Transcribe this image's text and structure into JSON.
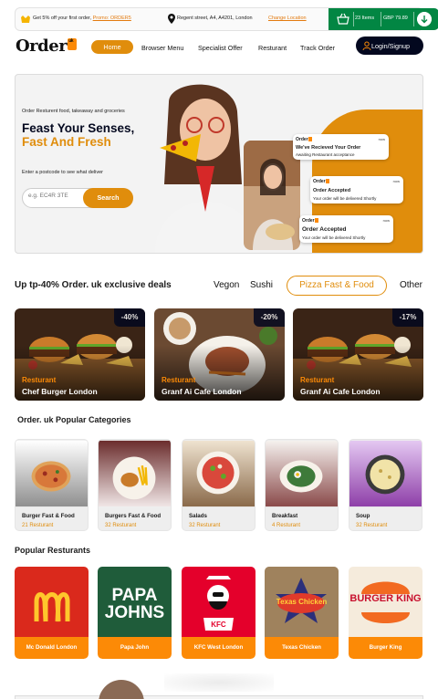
{
  "promo": {
    "text": "Get 5% off your first order, ",
    "code": "Promo: ORDER5",
    "address": "Regent street, A4, A4201, London",
    "change_location": "Change Location"
  },
  "cart": {
    "items": "23 Items",
    "price": "GBP 79.89"
  },
  "nav": {
    "logo": "Order",
    "logo_badge": "uk",
    "links": [
      "Home",
      "Browser Menu",
      "Specialist Offer",
      "Resturant",
      "Track Order"
    ],
    "login": "Login/Signup"
  },
  "hero": {
    "subtitle": "Order Resturent food, takeaway and groceries",
    "title_line1": "Feast Your Senses,",
    "title_line2": "Fast And Fresh",
    "postcode_label": "Enter a postcode to see what deliver",
    "search_placeholder": "e.g. EC4R 3TE",
    "search_button": "Search",
    "notifications": [
      {
        "brand": "Order",
        "time": "now",
        "title": "We've Recieved Your Order",
        "desc": "Awaiting Restaurant acceptance"
      },
      {
        "brand": "Order",
        "time": "now",
        "title": "Order Accepted",
        "desc": "Your order will be delivered Shortly"
      },
      {
        "brand": "Order",
        "time": "now",
        "title": "Order Accepted",
        "desc": "Your order will be delivered Shortly"
      }
    ]
  },
  "deals": {
    "title": "Up tp-40% Order. uk exclusive deals",
    "filters": [
      "Vegon",
      "Sushi",
      "Pizza Fast & Food",
      "Other"
    ],
    "active_filter": "Pizza Fast & Food",
    "cards": [
      {
        "discount": "-40%",
        "label": "Resturant",
        "name": "Chef Burger London"
      },
      {
        "discount": "-20%",
        "label": "Resturant",
        "name": "Granf Ai Cafe London"
      },
      {
        "discount": "-17%",
        "label": "Resturant",
        "name": "Granf Ai Cafe London"
      }
    ]
  },
  "categories": {
    "title": "Order. uk Popular Categories",
    "items": [
      {
        "name": "Burger Fast & Food",
        "count": "21 Resturant"
      },
      {
        "name": "Burgers Fast & Food",
        "count": "32 Resturant"
      },
      {
        "name": "Salads",
        "count": "32 Resturant"
      },
      {
        "name": "Breakfast",
        "count": "4 Resturant"
      },
      {
        "name": "Soup",
        "count": "32 Resturant"
      }
    ]
  },
  "restaurants": {
    "title": "Popular Resturants",
    "items": [
      {
        "name": "Mc Donald London",
        "logo": "M"
      },
      {
        "name": "Papa John",
        "logo": "PAPA JOHNS"
      },
      {
        "name": "KFC West London",
        "logo": "KFC"
      },
      {
        "name": "Texas Chicken",
        "logo": "Texas Chicken"
      },
      {
        "name": "Burger King",
        "logo": "BURGER KING"
      }
    ]
  },
  "colors": {
    "accent": "#e08d0c",
    "dark": "#03081f",
    "green": "#028643"
  }
}
